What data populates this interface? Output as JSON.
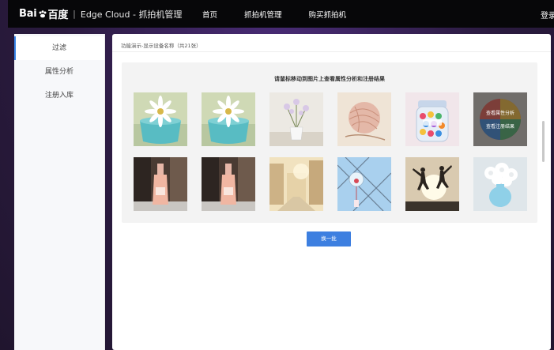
{
  "header": {
    "brand_left": "Bai",
    "brand_right": "百度",
    "separator": "|",
    "app_title": "Edge Cloud - 抓拍机管理",
    "nav": [
      {
        "label": "首页"
      },
      {
        "label": "抓拍机管理"
      },
      {
        "label": "购买抓拍机"
      }
    ],
    "login": "登录"
  },
  "sidebar": {
    "items": [
      {
        "label": "过滤",
        "active": true
      },
      {
        "label": "属性分析",
        "active": false
      },
      {
        "label": "注册入库",
        "active": false
      }
    ]
  },
  "main": {
    "breadcrumb": "功能演示-显示设备名称（共21张）",
    "hint": "请鼠标移动到图片上查看属性分析和注册结果",
    "hover_overlay": {
      "line1": "查看属性分析",
      "line2": "查看注册结果"
    },
    "images": [
      {
        "name": "daisy-teal-bowl"
      },
      {
        "name": "daisy-teal-bowl"
      },
      {
        "name": "flowers-vase"
      },
      {
        "name": "yarn-ball"
      },
      {
        "name": "candy-jar"
      },
      {
        "name": "colorful-balloon"
      },
      {
        "name": "pink-bottle"
      },
      {
        "name": "pink-bottle"
      },
      {
        "name": "city-street"
      },
      {
        "name": "wind-chime"
      },
      {
        "name": "jumping-silhouettes"
      },
      {
        "name": "white-flowers"
      }
    ],
    "refresh_button": "换一批"
  },
  "colors": {
    "accent": "#3d7fe0",
    "nav_bg": "#070709",
    "backdrop": "#2a1c3e"
  }
}
